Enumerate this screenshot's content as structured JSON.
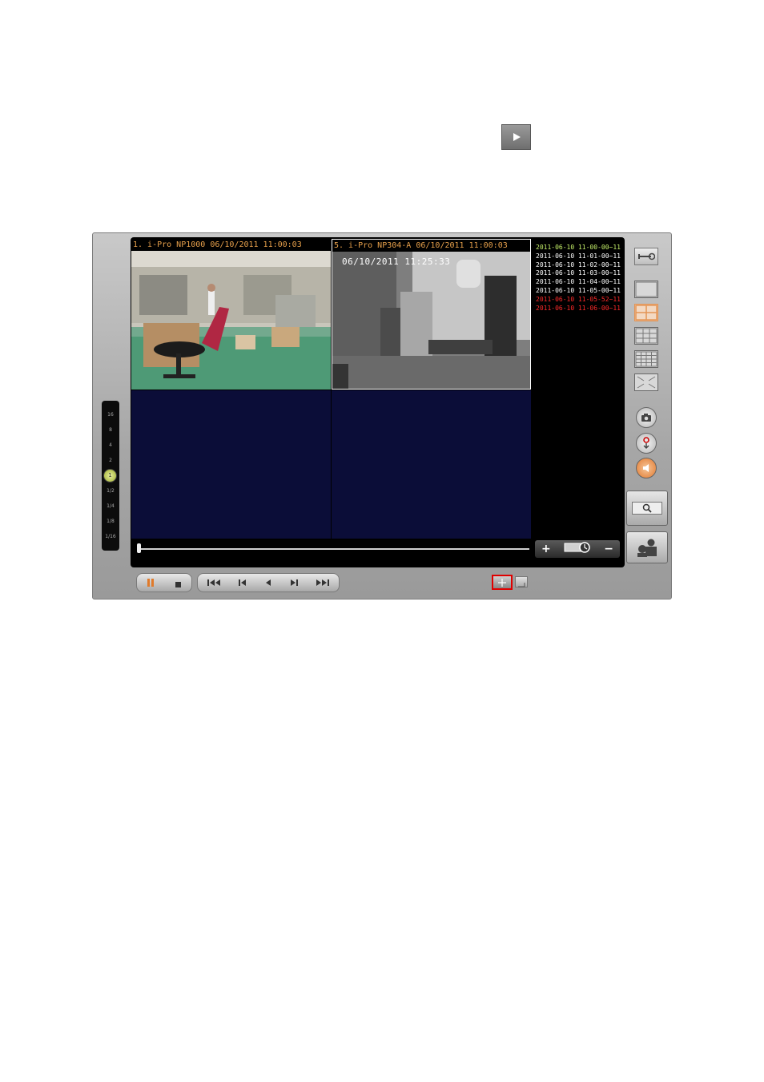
{
  "cameras": [
    {
      "title": "1. i-Pro NP1000 06/10/2011 11:00:03"
    },
    {
      "title": "5. i-Pro NP304-A 06/10/2011 11:00:03",
      "overlay_timestamp": "06/10/2011 11:25:33"
    }
  ],
  "records": [
    {
      "text": "2011-06-10 11-00-00~11-0",
      "color": "#c6f16a"
    },
    {
      "text": "2011-06-10 11-01-00~11-0",
      "color": "#ffffff"
    },
    {
      "text": "2011-06-10 11-02-00~11-0",
      "color": "#ffffff"
    },
    {
      "text": "2011-06-10 11-03-00~11-0",
      "color": "#ffffff"
    },
    {
      "text": "2011-06-10 11-04-00~11-0",
      "color": "#ffffff"
    },
    {
      "text": "2011-06-10 11-05-00~11-0",
      "color": "#ffffff"
    },
    {
      "text": "2011-06-10 11-05-52~11-0",
      "color": "#ff2a2a"
    },
    {
      "text": "2011-06-10 11-06-00~11-0",
      "color": "#ff2a2a"
    }
  ],
  "speed_scale": [
    "16",
    "8",
    "4",
    "2",
    "1",
    "1/2",
    "1/4",
    "1/8",
    "1/16"
  ],
  "speed_selected": "1",
  "timeline_position": 0.0,
  "icons": {
    "play_top": "play-icon",
    "settings": "wrench-icon",
    "layouts": [
      "layout-1x1-icon",
      "layout-2x2-icon",
      "layout-3x3-icon",
      "layout-4x4-icon",
      "fullscreen-icon"
    ],
    "snapshot": "camera-icon",
    "record_download": "download-icon",
    "audio": "speaker-icon",
    "search": "search-icon",
    "user": "user-icon"
  },
  "colors": {
    "tile_empty": "#0b0d38",
    "cam_title": "#e7a04b",
    "highlight": "#e00000",
    "active_layout": "#e39455"
  }
}
